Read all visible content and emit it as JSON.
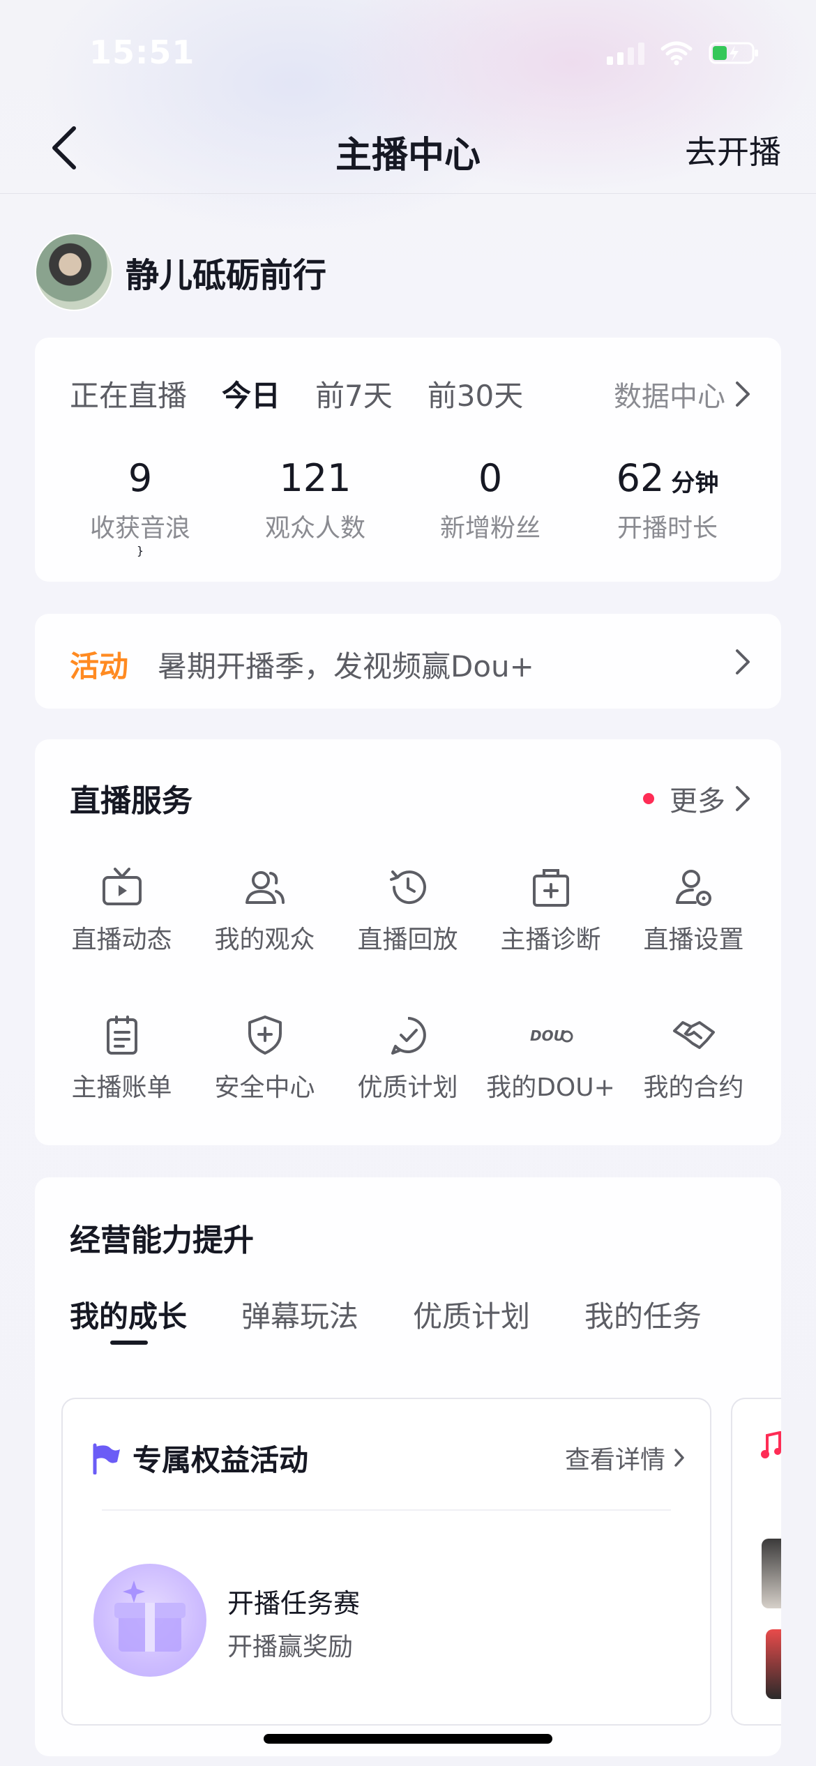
{
  "status_bar": {
    "time": "15:51"
  },
  "nav": {
    "title": "主播中心",
    "action": "去开播"
  },
  "profile": {
    "name": "静儿砥砺前行"
  },
  "stats": {
    "tabs": [
      "正在直播",
      "今日",
      "前7天",
      "前30天"
    ],
    "active_tab": "今日",
    "data_center": "数据中心",
    "items": [
      {
        "value": "9",
        "unit": "",
        "label": "收获音浪"
      },
      {
        "value": "121",
        "unit": "",
        "label": "观众人数"
      },
      {
        "value": "0",
        "unit": "",
        "label": "新增粉丝"
      },
      {
        "value": "62",
        "unit": "分钟",
        "label": "开播时长"
      }
    ]
  },
  "activity": {
    "tag": "活动",
    "text": "暑期开播季，发视频赢Dou+"
  },
  "live_service": {
    "title": "直播服务",
    "more": "更多",
    "items": [
      {
        "label": "直播动态",
        "icon": "tv-icon"
      },
      {
        "label": "我的观众",
        "icon": "audience-icon"
      },
      {
        "label": "直播回放",
        "icon": "replay-icon"
      },
      {
        "label": "主播诊断",
        "icon": "diagnosis-icon"
      },
      {
        "label": "直播设置",
        "icon": "user-settings-icon"
      },
      {
        "label": "主播账单",
        "icon": "bill-icon"
      },
      {
        "label": "安全中心",
        "icon": "shield-icon"
      },
      {
        "label": "优质计划",
        "icon": "check-badge-icon"
      },
      {
        "label": "我的DOU+",
        "icon": "dou-plus-icon",
        "icon_text": "DOU"
      },
      {
        "label": "我的合约",
        "icon": "handshake-icon"
      }
    ]
  },
  "growth": {
    "title": "经营能力提升",
    "tabs": [
      "我的成长",
      "弹幕玩法",
      "优质计划",
      "我的任务"
    ],
    "active_tab": "我的成长",
    "benefit": {
      "title": "专属权益活动",
      "detail": "查看详情",
      "item_title": "开播任务赛",
      "item_subtitle": "开播赢奖励"
    }
  },
  "colors": {
    "accent_orange": "#ff8a21",
    "dot_red": "#fe2c55",
    "flag_purple": "#6b5cf6"
  }
}
